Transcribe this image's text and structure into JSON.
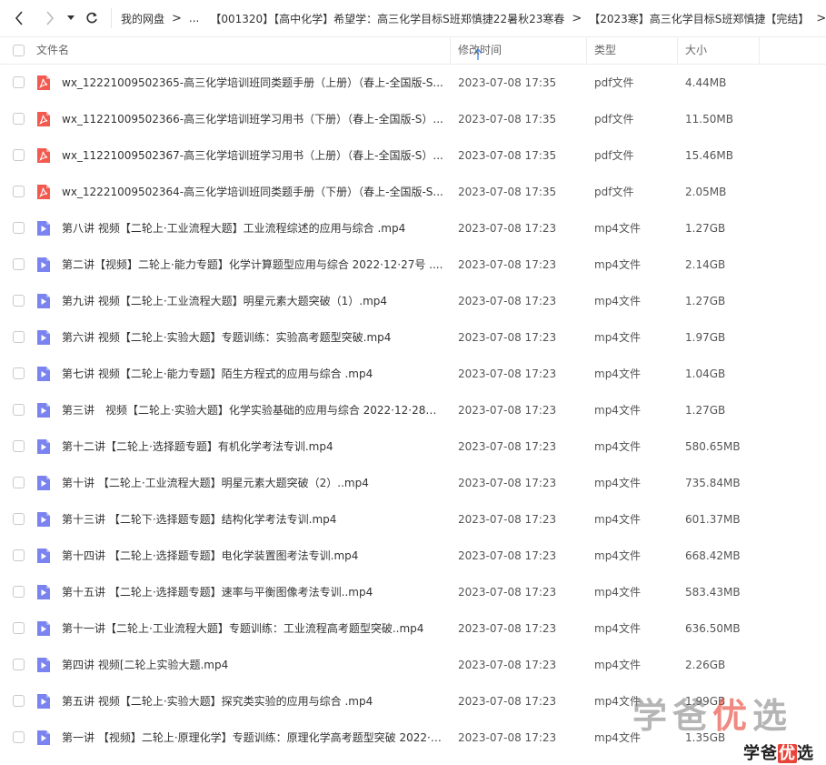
{
  "nav": {
    "breadcrumbs": [
      "我的网盘",
      "...",
      "【001320】【高中化学】希望学：高三化学目标S班郑慎捷22暑秋23寒春",
      "【2023寒】高三化学目标S班郑慎捷【完结】"
    ],
    "separator": ">"
  },
  "header": {
    "name": "文件名",
    "mtime": "修改时间",
    "type": "类型",
    "size": "大小"
  },
  "files": [
    {
      "icon": "pdf",
      "name": "wx_12221009502365-高三化学培训班同类题手册（上册）（春上-全国版-S...",
      "mtime": "2023-07-08 17:35",
      "type": "pdf文件",
      "size": "4.44MB"
    },
    {
      "icon": "pdf",
      "name": "wx_11221009502366-高三化学培训班学习用书（下册）（春上-全国版-S）...",
      "mtime": "2023-07-08 17:35",
      "type": "pdf文件",
      "size": "11.50MB"
    },
    {
      "icon": "pdf",
      "name": "wx_11221009502367-高三化学培训班学习用书（上册）（春上-全国版-S）...",
      "mtime": "2023-07-08 17:35",
      "type": "pdf文件",
      "size": "15.46MB"
    },
    {
      "icon": "pdf",
      "name": "wx_12221009502364-高三化学培训班同类题手册（下册）（春上-全国版-S...",
      "mtime": "2023-07-08 17:35",
      "type": "pdf文件",
      "size": "2.05MB"
    },
    {
      "icon": "video",
      "name": "第八讲 视频【二轮上·工业流程大题】工业流程综述的应用与综合 .mp4",
      "mtime": "2023-07-08 17:23",
      "type": "mp4文件",
      "size": "1.27GB"
    },
    {
      "icon": "video",
      "name": "第二讲【视频】二轮上·能力专题】化学计算题型应用与综合 2022·12·27号 ....",
      "mtime": "2023-07-08 17:23",
      "type": "mp4文件",
      "size": "2.14GB"
    },
    {
      "icon": "video",
      "name": "第九讲 视频【二轮上·工业流程大题】明星元素大题突破（1）.mp4",
      "mtime": "2023-07-08 17:23",
      "type": "mp4文件",
      "size": "1.27GB"
    },
    {
      "icon": "video",
      "name": "第六讲 视频【二轮上·实验大题】专题训练：实验高考题型突破.mp4",
      "mtime": "2023-07-08 17:23",
      "type": "mp4文件",
      "size": "1.97GB"
    },
    {
      "icon": "video",
      "name": "第七讲 视频【二轮上·能力专题】陌生方程式的应用与综合 .mp4",
      "mtime": "2023-07-08 17:23",
      "type": "mp4文件",
      "size": "1.04GB"
    },
    {
      "icon": "video",
      "name": "第三讲　视频【二轮上·实验大题】化学实验基础的应用与综合 2022·12·28号...",
      "mtime": "2023-07-08 17:23",
      "type": "mp4文件",
      "size": "1.27GB"
    },
    {
      "icon": "video",
      "name": "第十二讲【二轮上·选择题专题】有机化学考法专训.mp4",
      "mtime": "2023-07-08 17:23",
      "type": "mp4文件",
      "size": "580.65MB"
    },
    {
      "icon": "video",
      "name": "第十讲 【二轮上·工业流程大题】明星元素大题突破（2）..mp4",
      "mtime": "2023-07-08 17:23",
      "type": "mp4文件",
      "size": "735.84MB"
    },
    {
      "icon": "video",
      "name": "第十三讲 【二轮下·选择题专题】结构化学考法专训.mp4",
      "mtime": "2023-07-08 17:23",
      "type": "mp4文件",
      "size": "601.37MB"
    },
    {
      "icon": "video",
      "name": "第十四讲 【二轮上·选择题专题】电化学装置图考法专训.mp4",
      "mtime": "2023-07-08 17:23",
      "type": "mp4文件",
      "size": "668.42MB"
    },
    {
      "icon": "video",
      "name": "第十五讲 【二轮上·选择题专题】速率与平衡图像考法专训..mp4",
      "mtime": "2023-07-08 17:23",
      "type": "mp4文件",
      "size": "583.43MB"
    },
    {
      "icon": "video",
      "name": "第十一讲【二轮上·工业流程大题】专题训练：工业流程高考题型突破..mp4",
      "mtime": "2023-07-08 17:23",
      "type": "mp4文件",
      "size": "636.50MB"
    },
    {
      "icon": "video",
      "name": "第四讲 视频[二轮上实验大题.mp4",
      "mtime": "2023-07-08 17:23",
      "type": "mp4文件",
      "size": "2.26GB"
    },
    {
      "icon": "video",
      "name": "第五讲 视频【二轮上·实验大题】探究类实验的应用与综合 .mp4",
      "mtime": "2023-07-08 17:23",
      "type": "mp4文件",
      "size": "1.99GB"
    },
    {
      "icon": "video",
      "name": "第一讲 【视频】二轮上·原理化学】专题训练：原理化学高考题型突破 2022·1...",
      "mtime": "2023-07-08 17:23",
      "type": "mp4文件",
      "size": "1.35GB"
    }
  ],
  "watermark": {
    "big_prefix": "学爸",
    "big_highlight": "优",
    "big_suffix": "选",
    "small_prefix": "学爸",
    "small_highlight": "优",
    "small_suffix": "选"
  },
  "colors": {
    "pdf_icon": "#f25a4f",
    "video_icon": "#7b83f0",
    "watermark_red": "#e8443a"
  }
}
